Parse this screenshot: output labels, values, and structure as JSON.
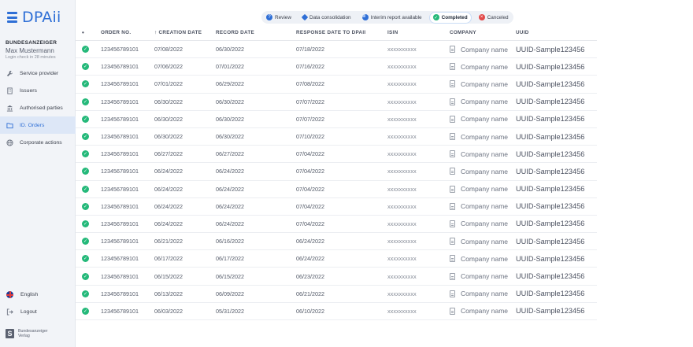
{
  "app": {
    "logo_text": "DPAii"
  },
  "user": {
    "org": "BUNDESANZEIGER",
    "name": "Max Mustermann",
    "login_check": "Login check in 28 minutes"
  },
  "nav": [
    {
      "label": "Service provider",
      "icon": "wrench-icon",
      "active": false
    },
    {
      "label": "Issuers",
      "icon": "building-icon",
      "active": false
    },
    {
      "label": "Authorised parties",
      "icon": "bank-icon",
      "active": false
    },
    {
      "label": "ID. Orders",
      "icon": "folder-icon",
      "active": true
    },
    {
      "label": "Corporate actions",
      "icon": "globe-icon",
      "active": false
    }
  ],
  "footer": {
    "language": "English",
    "logout": "Logout",
    "publisher_line1": "Bundesanzeiger",
    "publisher_line2": "Verlag"
  },
  "filters": [
    {
      "label": "Review",
      "icon": "review-dot",
      "active": false
    },
    {
      "label": "Data consolidation",
      "icon": "consolidation-icon",
      "active": false
    },
    {
      "label": "Interim report available",
      "icon": "pie-icon",
      "active": false
    },
    {
      "label": "Completed",
      "icon": "check-icon",
      "active": true
    },
    {
      "label": "Canceled",
      "icon": "cancel-icon",
      "active": false
    }
  ],
  "table": {
    "headers": {
      "status": "•",
      "order_no": "ORDER NO.",
      "creation_date": "↑ CREATION DATE",
      "record_date": "RECORD DATE",
      "response_date": "RESPONSE DATE TO DPAII",
      "isin": "ISIN",
      "company": "COMPANY",
      "uuid": "UUID"
    },
    "rows": [
      {
        "order_no": "123456789101",
        "created": "07/08/2022",
        "record": "06/30/2022",
        "response": "07/18/2022",
        "isin": "XXXXXXXXXX",
        "company": "Company name",
        "uuid": "UUID-Sample123456"
      },
      {
        "order_no": "123456789101",
        "created": "07/06/2022",
        "record": "07/01/2022",
        "response": "07/16/2022",
        "isin": "XXXXXXXXXX",
        "company": "Company name",
        "uuid": "UUID-Sample123456"
      },
      {
        "order_no": "123456789101",
        "created": "07/01/2022",
        "record": "06/29/2022",
        "response": "07/08/2022",
        "isin": "XXXXXXXXXX",
        "company": "Company name",
        "uuid": "UUID-Sample123456"
      },
      {
        "order_no": "123456789101",
        "created": "06/30/2022",
        "record": "06/30/2022",
        "response": "07/07/2022",
        "isin": "XXXXXXXXXX",
        "company": "Company name",
        "uuid": "UUID-Sample123456"
      },
      {
        "order_no": "123456789101",
        "created": "06/30/2022",
        "record": "06/30/2022",
        "response": "07/07/2022",
        "isin": "XXXXXXXXXX",
        "company": "Company name",
        "uuid": "UUID-Sample123456"
      },
      {
        "order_no": "123456789101",
        "created": "06/30/2022",
        "record": "06/30/2022",
        "response": "07/10/2022",
        "isin": "XXXXXXXXXX",
        "company": "Company name",
        "uuid": "UUID-Sample123456"
      },
      {
        "order_no": "123456789101",
        "created": "06/27/2022",
        "record": "06/27/2022",
        "response": "07/04/2022",
        "isin": "XXXXXXXXXX",
        "company": "Company name",
        "uuid": "UUID-Sample123456"
      },
      {
        "order_no": "123456789101",
        "created": "06/24/2022",
        "record": "06/24/2022",
        "response": "07/04/2022",
        "isin": "XXXXXXXXXX",
        "company": "Company name",
        "uuid": "UUID-Sample123456"
      },
      {
        "order_no": "123456789101",
        "created": "06/24/2022",
        "record": "06/24/2022",
        "response": "07/04/2022",
        "isin": "XXXXXXXXXX",
        "company": "Company name",
        "uuid": "UUID-Sample123456"
      },
      {
        "order_no": "123456789101",
        "created": "06/24/2022",
        "record": "06/24/2022",
        "response": "07/04/2022",
        "isin": "XXXXXXXXXX",
        "company": "Company name",
        "uuid": "UUID-Sample123456"
      },
      {
        "order_no": "123456789101",
        "created": "06/24/2022",
        "record": "06/24/2022",
        "response": "07/04/2022",
        "isin": "XXXXXXXXXX",
        "company": "Company name",
        "uuid": "UUID-Sample123456"
      },
      {
        "order_no": "123456789101",
        "created": "06/21/2022",
        "record": "06/16/2022",
        "response": "06/24/2022",
        "isin": "XXXXXXXXXX",
        "company": "Company name",
        "uuid": "UUID-Sample123456"
      },
      {
        "order_no": "123456789101",
        "created": "06/17/2022",
        "record": "06/17/2022",
        "response": "06/24/2022",
        "isin": "XXXXXXXXXX",
        "company": "Company name",
        "uuid": "UUID-Sample123456"
      },
      {
        "order_no": "123456789101",
        "created": "06/15/2022",
        "record": "06/15/2022",
        "response": "06/23/2022",
        "isin": "XXXXXXXXXX",
        "company": "Company name",
        "uuid": "UUID-Sample123456"
      },
      {
        "order_no": "123456789101",
        "created": "06/13/2022",
        "record": "06/09/2022",
        "response": "06/21/2022",
        "isin": "XXXXXXXXXX",
        "company": "Company name",
        "uuid": "UUID-Sample123456"
      },
      {
        "order_no": "123456789101",
        "created": "06/03/2022",
        "record": "05/31/2022",
        "response": "06/10/2022",
        "isin": "XXXXXXXXXX",
        "company": "Company name",
        "uuid": "UUID-Sample123456"
      }
    ]
  },
  "colors": {
    "brand": "#2f6fd6",
    "completed": "#25b97a",
    "canceled": "#e24a4a",
    "sidebar_bg": "#f2f4f8",
    "active_nav_bg": "#dde7f7"
  }
}
